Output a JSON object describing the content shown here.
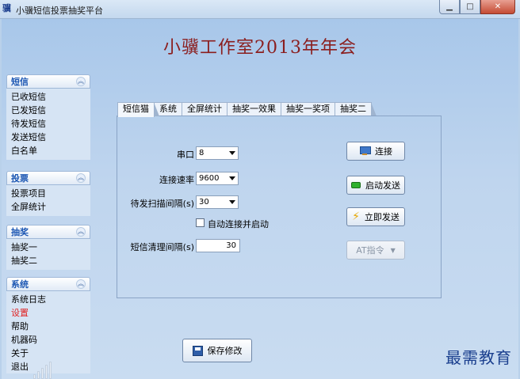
{
  "window": {
    "title": "小骥短信投票抽奖平台",
    "controls": {
      "minimize": "▁",
      "maximize": "□",
      "close": "✕"
    }
  },
  "banner": {
    "title": "小骥工作室2013年年会"
  },
  "sidebar": {
    "groups": [
      {
        "title": "短信",
        "items": [
          "已收短信",
          "已发短信",
          "待发短信",
          "发送短信",
          "白名单"
        ]
      },
      {
        "title": "投票",
        "items": [
          "投票项目",
          "全屏统计"
        ]
      },
      {
        "title": "抽奖",
        "items": [
          "抽奖一",
          "抽奖二"
        ]
      },
      {
        "title": "系统",
        "items": [
          "系统日志",
          "设置",
          "帮助",
          "机器码",
          "关于",
          "退出"
        ],
        "active": "设置"
      }
    ]
  },
  "tabs": [
    "短信猫",
    "系统",
    "全屏统计",
    "抽奖一效果",
    "抽奖一奖项",
    "抽奖二"
  ],
  "form": {
    "port_label": "串口",
    "port_value": "8",
    "baud_label": "连接速率",
    "baud_value": "9600",
    "scan_label": "待发扫描间隔(s)",
    "scan_value": "30",
    "autoconnect_label": "自动连接并启动",
    "clean_label": "短信清理间隔(s)",
    "clean_value": "30"
  },
  "buttons": {
    "connect": "连接",
    "start_send": "启动发送",
    "send_now": "立即发送",
    "at_command": "AT指令",
    "save": "保存修改"
  },
  "watermark": "最需教育",
  "colors": {
    "banner_title": "#8b1e1e",
    "group_title": "#1c57b3",
    "active_item": "#e02020"
  }
}
